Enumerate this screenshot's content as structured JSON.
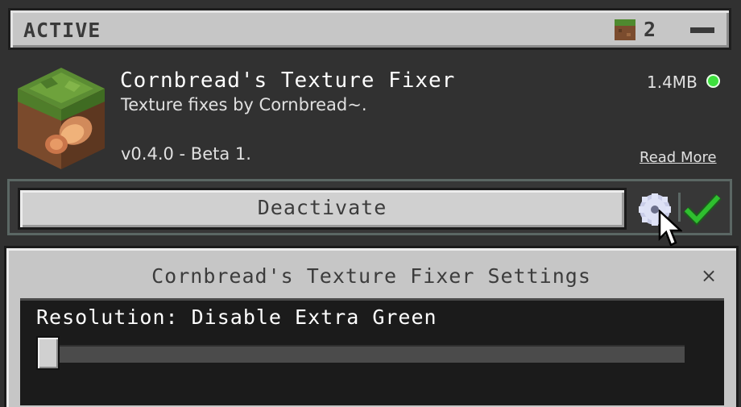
{
  "header": {
    "title": "ACTIVE",
    "pack_count": "2",
    "collapse_icon": "minus-icon"
  },
  "pack": {
    "name": "Cornbread's Texture Fixer",
    "description": "Texture fixes by Cornbread~.",
    "version": "v0.4.0 - Beta 1.",
    "size": "1.4MB",
    "status_color": "#3ee03e",
    "read_more_label": "Read More",
    "thumbnail_icon": "grass-block-icon"
  },
  "actions": {
    "deactivate_label": "Deactivate",
    "settings_icon": "gear-icon",
    "apply_icon": "checkmark-icon"
  },
  "settings_dialog": {
    "title": "Cornbread's Texture Fixer Settings",
    "close_label": "×",
    "resolution_label": "Resolution: Disable Extra Green",
    "resolution_value": 0
  }
}
